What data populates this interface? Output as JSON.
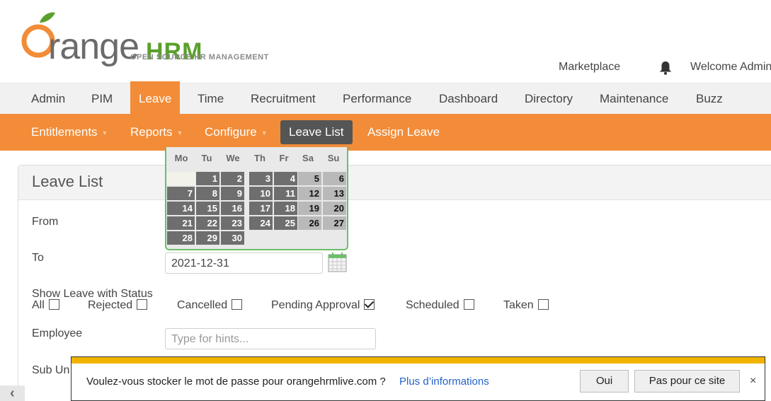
{
  "header": {
    "logo_main": "range",
    "logo_hrm": "HRM",
    "logo_tagline": "OPEN SOURCE HR MANAGEMENT",
    "marketplace": "Marketplace",
    "welcome": "Welcome Admin"
  },
  "main_nav": [
    {
      "label": "Admin"
    },
    {
      "label": "PIM"
    },
    {
      "label": "Leave",
      "active": true
    },
    {
      "label": "Time"
    },
    {
      "label": "Recruitment"
    },
    {
      "label": "Performance"
    },
    {
      "label": "Dashboard"
    },
    {
      "label": "Directory"
    },
    {
      "label": "Maintenance"
    },
    {
      "label": "Buzz"
    }
  ],
  "sub_nav": [
    {
      "label": "Entitlements",
      "caret": "▼"
    },
    {
      "label": "Reports",
      "caret": "▼"
    },
    {
      "label": "Configure",
      "caret": "▼"
    },
    {
      "label": "Leave List",
      "active": true
    },
    {
      "label": "Assign Leave"
    }
  ],
  "panel": {
    "title": "Leave List",
    "from_label": "From",
    "to_label": "To",
    "to_value": "2021-12-31",
    "status_label": "Show Leave with Status",
    "statuses": [
      {
        "label": "All",
        "checked": false
      },
      {
        "label": "Rejected",
        "checked": false
      },
      {
        "label": "Cancelled",
        "checked": false
      },
      {
        "label": "Pending Approval",
        "checked": true
      },
      {
        "label": "Scheduled",
        "checked": false
      },
      {
        "label": "Taken",
        "checked": false
      }
    ],
    "employee_label": "Employee",
    "employee_placeholder": "Type for hints...",
    "subunit_label": "Sub Un"
  },
  "datepicker": {
    "weekdays": [
      "Mo",
      "Tu",
      "We",
      "Th",
      "Fr",
      "Sa",
      "Su"
    ],
    "first_weekday_index": 1,
    "days_in_month": 30
  },
  "password_bar": {
    "message": "Voulez-vous stocker le mot de passe pour orangehrmlive.com ?",
    "more_info": "Plus d’informations",
    "yes": "Oui",
    "never": "Pas pour ce site",
    "close": "×"
  },
  "colors": {
    "accent": "#f28c38",
    "active_sub": "#555555",
    "datepicker_border": "#6cbf6a",
    "password_bar_accent": "#f0b400",
    "link": "#2563c9"
  }
}
